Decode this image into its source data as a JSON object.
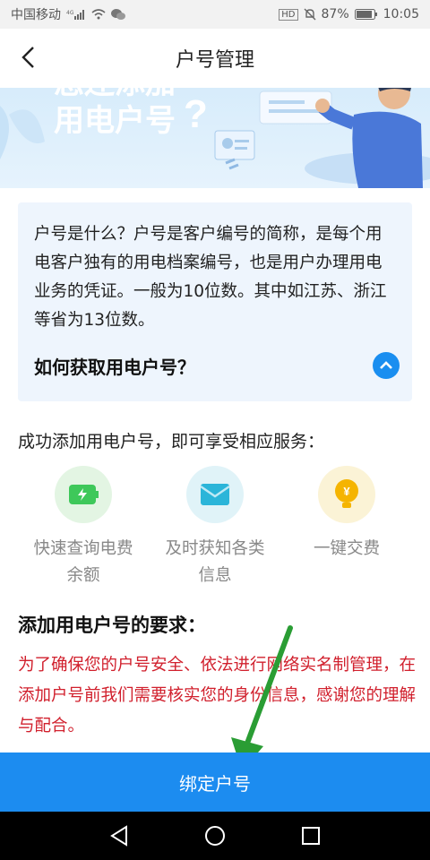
{
  "status_bar": {
    "carrier": "中国移动",
    "network": "4G",
    "hd": "HD",
    "battery": "87%",
    "time": "10:05"
  },
  "header": {
    "title": "户号管理",
    "back_icon": "chevron-left-icon"
  },
  "banner": {
    "text_line1": "您还添加",
    "text_line2": "用电户号"
  },
  "info_card": {
    "text": "户号是什么？户号是客户编号的简称，是每个用电客户独有的用电档案编号，也是用户办理用电业务的凭证。一般为10位数。其中如江苏、浙江等省为13位数。",
    "faq_title": "如何获取用电户号？",
    "faq_icon": "chevron-up-icon"
  },
  "services": {
    "title": "成功添加用电户号，即可享受相应服务：",
    "items": [
      {
        "label": "快速查询电费余额",
        "icon": "battery-icon",
        "bg": "#e3f5e3"
      },
      {
        "label": "及时获知各类信息",
        "icon": "envelope-icon",
        "bg": "#e0f3f8"
      },
      {
        "label": "一键交费",
        "icon": "coin-bulb-icon",
        "bg": "#fbf3d6"
      }
    ]
  },
  "requirements": {
    "title": "添加用电户号的要求：",
    "text": "为了确保您的户号安全、依法进行网络实名制管理，在添加户号前我们需要核实您的身份信息，感谢您的理解与配合。"
  },
  "bind_button": {
    "label": "绑定户号"
  },
  "colors": {
    "primary": "#1c8cf0",
    "warning_text": "#d1202d",
    "annotation_arrow": "#2a9d34"
  }
}
